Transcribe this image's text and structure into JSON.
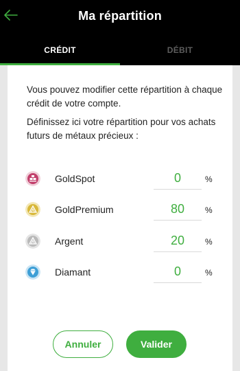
{
  "header": {
    "title": "Ma répartition",
    "back_icon": "arrow-left-icon",
    "accent_color": "#3fae3f"
  },
  "tabs": [
    {
      "label": "CRÉDIT",
      "active": true
    },
    {
      "label": "DÉBIT",
      "active": false
    }
  ],
  "content": {
    "intro_1": "Vous pouvez modifier cette répartition à chaque crédit de votre compte.",
    "intro_2": "Définissez ici votre répartition pour vos achats futurs de métaux précieux :"
  },
  "allocations": [
    {
      "label": "GoldSpot",
      "value": "0",
      "unit": "%",
      "icon": "goldspot-icon",
      "color": "#c2406c"
    },
    {
      "label": "GoldPremium",
      "value": "80",
      "unit": "%",
      "icon": "goldpremium-icon",
      "color": "#d8b83a"
    },
    {
      "label": "Argent",
      "value": "20",
      "unit": "%",
      "icon": "silver-icon",
      "color": "#b9b9b9"
    },
    {
      "label": "Diamant",
      "value": "0",
      "unit": "%",
      "icon": "diamond-icon",
      "color": "#3e9fd6"
    }
  ],
  "actions": {
    "cancel_label": "Annuler",
    "validate_label": "Valider"
  }
}
